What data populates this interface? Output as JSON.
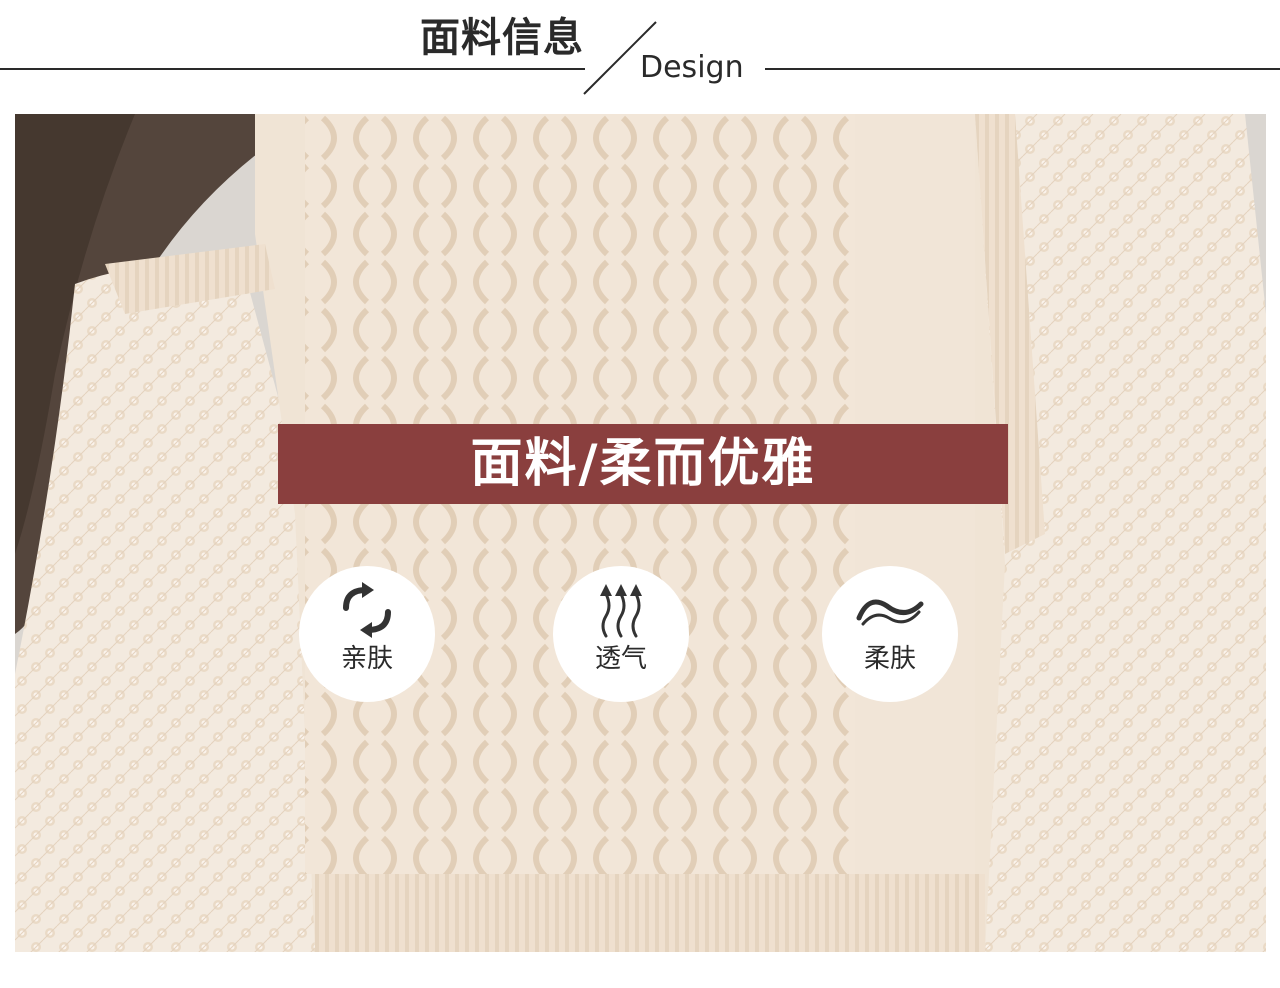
{
  "header": {
    "title_cn": "面料信息",
    "title_en": "Design"
  },
  "banner": {
    "text": "面料/柔而优雅"
  },
  "features": [
    {
      "label": "亲肤",
      "icon": "refresh-arrows-icon"
    },
    {
      "label": "透气",
      "icon": "breathable-arrows-icon"
    },
    {
      "label": "柔肤",
      "icon": "soft-wave-icon"
    }
  ],
  "colors": {
    "banner": "#8a3f3e",
    "text_dark": "#2a2a2a",
    "knit_base": "#efe2d2"
  }
}
